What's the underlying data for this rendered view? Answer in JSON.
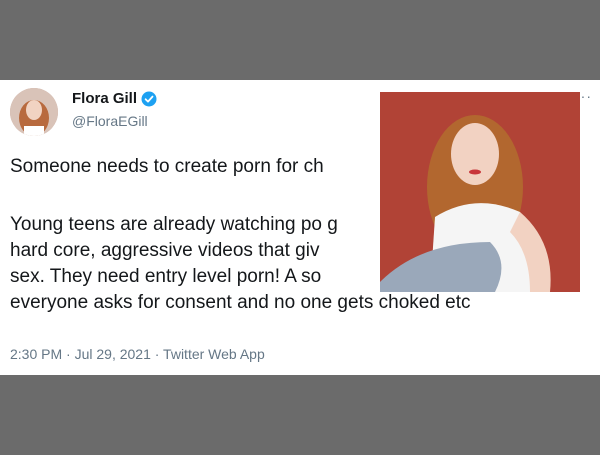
{
  "tweet": {
    "author_name": "Flora Gill",
    "author_handle": "@FloraEGill",
    "more_label": "···",
    "lines": [
      "Someone needs to create porn for ch",
      "Young teens are already watching po                                  g",
      "hard core, aggressive videos that giv",
      "sex. They need entry level porn! A so",
      "everyone asks for consent and no one gets choked etc"
    ],
    "timestamp": "2:30 PM · Jul 29, 2021 · Twitter Web App"
  },
  "icons": {
    "verified": "verified-badge-icon",
    "more": "more-options-icon"
  },
  "colors": {
    "page_bg": "#6b6b6b",
    "card_bg": "#ffffff",
    "text": "#14171a",
    "secondary_text": "#657786",
    "verified_blue": "#1da1f2",
    "photo_bg": "#b7473a"
  }
}
